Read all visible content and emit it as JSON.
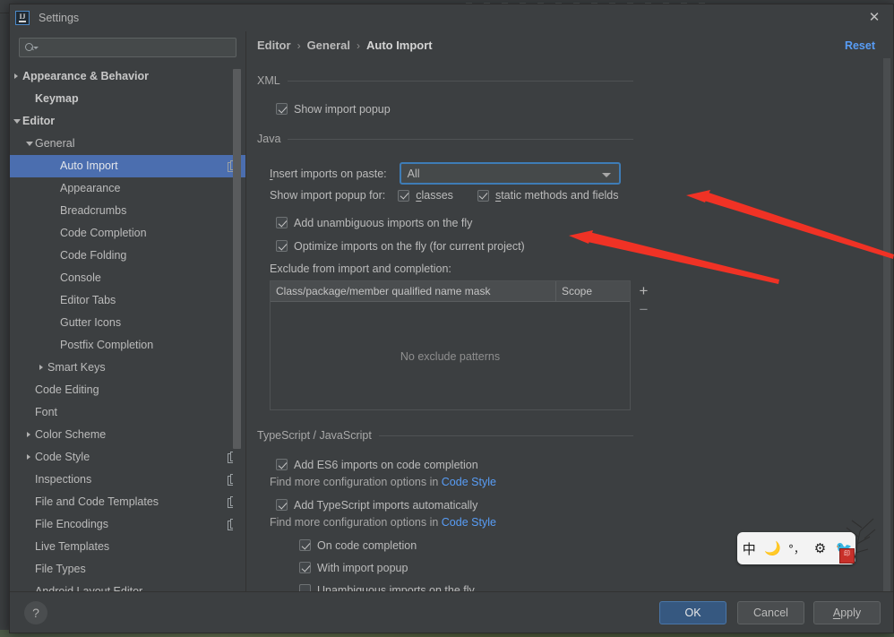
{
  "window": {
    "title": "Settings",
    "logo_icon": "intellij-idea-logo",
    "close_icon": "close-icon"
  },
  "sidebar": {
    "search": {
      "value": "",
      "placeholder": "",
      "icon": "search-icon",
      "dropdown_icon": "chevron-down-icon"
    },
    "items": [
      {
        "label": "Appearance & Behavior",
        "indent": 0,
        "arrow": "collapsed",
        "bold": true,
        "selected": false,
        "badge": false
      },
      {
        "label": "Keymap",
        "indent": 1,
        "arrow": "none",
        "bold": true,
        "selected": false,
        "badge": false
      },
      {
        "label": "Editor",
        "indent": 0,
        "arrow": "expanded",
        "bold": true,
        "selected": false,
        "badge": false
      },
      {
        "label": "General",
        "indent": 1,
        "arrow": "expanded",
        "bold": false,
        "selected": false,
        "badge": false
      },
      {
        "label": "Auto Import",
        "indent": 3,
        "arrow": "none",
        "bold": false,
        "selected": true,
        "badge": true
      },
      {
        "label": "Appearance",
        "indent": 3,
        "arrow": "none",
        "bold": false,
        "selected": false,
        "badge": false
      },
      {
        "label": "Breadcrumbs",
        "indent": 3,
        "arrow": "none",
        "bold": false,
        "selected": false,
        "badge": false
      },
      {
        "label": "Code Completion",
        "indent": 3,
        "arrow": "none",
        "bold": false,
        "selected": false,
        "badge": false
      },
      {
        "label": "Code Folding",
        "indent": 3,
        "arrow": "none",
        "bold": false,
        "selected": false,
        "badge": false
      },
      {
        "label": "Console",
        "indent": 3,
        "arrow": "none",
        "bold": false,
        "selected": false,
        "badge": false
      },
      {
        "label": "Editor Tabs",
        "indent": 3,
        "arrow": "none",
        "bold": false,
        "selected": false,
        "badge": false
      },
      {
        "label": "Gutter Icons",
        "indent": 3,
        "arrow": "none",
        "bold": false,
        "selected": false,
        "badge": false
      },
      {
        "label": "Postfix Completion",
        "indent": 3,
        "arrow": "none",
        "bold": false,
        "selected": false,
        "badge": false
      },
      {
        "label": "Smart Keys",
        "indent": 2,
        "arrow": "collapsed",
        "bold": false,
        "selected": false,
        "badge": false
      },
      {
        "label": "Code Editing",
        "indent": 1,
        "arrow": "none",
        "bold": false,
        "selected": false,
        "badge": false
      },
      {
        "label": "Font",
        "indent": 1,
        "arrow": "none",
        "bold": false,
        "selected": false,
        "badge": false
      },
      {
        "label": "Color Scheme",
        "indent": 1,
        "arrow": "collapsed",
        "bold": false,
        "selected": false,
        "badge": false
      },
      {
        "label": "Code Style",
        "indent": 1,
        "arrow": "collapsed",
        "bold": false,
        "selected": false,
        "badge": true
      },
      {
        "label": "Inspections",
        "indent": 1,
        "arrow": "none",
        "bold": false,
        "selected": false,
        "badge": true
      },
      {
        "label": "File and Code Templates",
        "indent": 1,
        "arrow": "none",
        "bold": false,
        "selected": false,
        "badge": true
      },
      {
        "label": "File Encodings",
        "indent": 1,
        "arrow": "none",
        "bold": false,
        "selected": false,
        "badge": true
      },
      {
        "label": "Live Templates",
        "indent": 1,
        "arrow": "none",
        "bold": false,
        "selected": false,
        "badge": false
      },
      {
        "label": "File Types",
        "indent": 1,
        "arrow": "none",
        "bold": false,
        "selected": false,
        "badge": false
      },
      {
        "label": "Android Layout Editor",
        "indent": 1,
        "arrow": "none",
        "bold": false,
        "selected": false,
        "badge": false
      }
    ]
  },
  "content": {
    "breadcrumb": {
      "root": "Editor",
      "mid": "General",
      "leaf": "Auto Import",
      "separator": "›"
    },
    "reset_label": "Reset",
    "xml": {
      "title": "XML",
      "show_import_popup": {
        "label": "Show import popup",
        "checked": true
      }
    },
    "java": {
      "title": "Java",
      "insert_imports_label": "Insert imports on paste:",
      "insert_imports_value": "All",
      "show_popup_for_label": "Show import popup for:",
      "classes": {
        "label": "classes",
        "checked": true
      },
      "static_methods": {
        "label": "static methods and fields",
        "checked": true
      },
      "add_unambiguous": {
        "label": "Add unambiguous imports on the fly",
        "checked": true
      },
      "optimize_imports": {
        "label": "Optimize imports on the fly (for current project)",
        "checked": true
      },
      "exclude_label": "Exclude from import and completion:",
      "table": {
        "columns": [
          "Class/package/member qualified name mask",
          "Scope"
        ],
        "rows": [],
        "empty_text": "No exclude patterns",
        "add_label": "+",
        "remove_label": "−"
      }
    },
    "tsjs": {
      "title": "TypeScript / JavaScript",
      "add_es6": {
        "label": "Add ES6 imports on code completion",
        "checked": true
      },
      "hint1_prefix": "Find more configuration options in ",
      "hint1_link": "Code Style",
      "add_ts": {
        "label": "Add TypeScript imports automatically",
        "checked": true
      },
      "hint2_prefix": "Find more configuration options in ",
      "hint2_link": "Code Style",
      "on_completion": {
        "label": "On code completion",
        "checked": true
      },
      "with_popup": {
        "label": "With import popup",
        "checked": true
      },
      "unambiguous_fly": {
        "label": "Unambiguous imports on the fly",
        "checked": false
      }
    }
  },
  "footer": {
    "help_label": "?",
    "ok_label": "OK",
    "cancel_label": "Cancel",
    "apply_label": "Apply"
  },
  "ime_bar": {
    "mode_label": "中",
    "moon_icon": "moon-icon",
    "punctuation_label": "°，",
    "gear_icon": "gear-icon",
    "stamp_label": "印"
  },
  "colors": {
    "accent_blue": "#4b6eaf",
    "link_blue": "#589df6",
    "panel_bg": "#3c3f41",
    "primary_button": "#365880",
    "annotation_red": "#f03225"
  }
}
